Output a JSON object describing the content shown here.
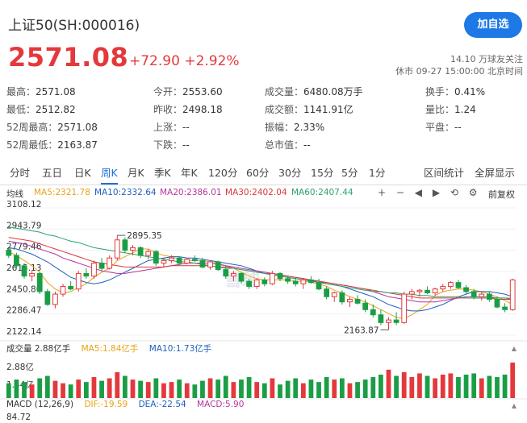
{
  "header": {
    "title": "上证50(SH:000016)",
    "follow_label": "加自选",
    "price": "2571.08",
    "change": "+72.90",
    "change_pct": "+2.92%",
    "followers": "14.10 万球友关注",
    "status": "休市 09-27 15:00:00 北京时间"
  },
  "quote": [
    [
      {
        "label": "最高：",
        "value": "2571.08",
        "color": "red"
      },
      {
        "label": "今开：",
        "value": "2553.60",
        "color": "red"
      },
      {
        "label": "成交量：",
        "value": "6480.08万手",
        "color": ""
      },
      {
        "label": "换手：",
        "value": "0.41%",
        "color": ""
      }
    ],
    [
      {
        "label": "最低：",
        "value": "2512.82",
        "color": "red"
      },
      {
        "label": "昨收：",
        "value": "2498.18",
        "color": ""
      },
      {
        "label": "成交额：",
        "value": "1141.91亿",
        "color": ""
      },
      {
        "label": "量比：",
        "value": "1.24",
        "color": "red"
      }
    ],
    [
      {
        "label": "52周最高：",
        "value": "2571.08",
        "color": ""
      },
      {
        "label": "上涨：",
        "value": "--",
        "color": ""
      },
      {
        "label": "振幅：",
        "value": "2.33%",
        "color": ""
      },
      {
        "label": "平盘：",
        "value": "--",
        "color": ""
      }
    ],
    [
      {
        "label": "52周最低：",
        "value": "2163.87",
        "color": ""
      },
      {
        "label": "下跌：",
        "value": "--",
        "color": ""
      },
      {
        "label": "总市值：",
        "value": "--",
        "color": ""
      }
    ]
  ],
  "tabs": [
    "分时",
    "五日",
    "日K",
    "周K",
    "月K",
    "季K",
    "年K",
    "120分",
    "60分",
    "30分",
    "15分",
    "5分",
    "1分"
  ],
  "active_tab": "周K",
  "tab_actions": [
    "区间统计",
    "全屏显示"
  ],
  "ma_line": {
    "label": "均线",
    "items": [
      {
        "text": "MA5:2321.78",
        "color": "#e8a317"
      },
      {
        "text": "MA10:2332.64",
        "color": "#1f5fbf"
      },
      {
        "text": "MA20:2386.01",
        "color": "#b5359d"
      },
      {
        "text": "MA30:2402.04",
        "color": "#d9383a"
      },
      {
        "text": "MA60:2407.44",
        "color": "#2ca36d"
      }
    ],
    "adjust": "前复权"
  },
  "watermark": "雪球",
  "chart_data": {
    "type": "candlestick",
    "y_ticks": [
      "3108.12",
      "2943.79",
      "2779.46",
      "2615.13",
      "2450.80",
      "2286.47",
      "2122.14"
    ],
    "ylim": [
      2122.14,
      3108.12
    ],
    "annotations": [
      {
        "text": "2895.35",
        "value": 2895.35
      },
      {
        "text": "2163.87",
        "value": 2163.87
      }
    ],
    "candles": [
      [
        2780,
        2800,
        2720,
        2740
      ],
      [
        2740,
        2760,
        2640,
        2660
      ],
      [
        2660,
        2680,
        2560,
        2580
      ],
      [
        2580,
        2620,
        2540,
        2600
      ],
      [
        2600,
        2610,
        2440,
        2460
      ],
      [
        2460,
        2480,
        2350,
        2360
      ],
      [
        2360,
        2460,
        2330,
        2440
      ],
      [
        2440,
        2520,
        2420,
        2500
      ],
      [
        2500,
        2540,
        2470,
        2480
      ],
      [
        2480,
        2620,
        2460,
        2600
      ],
      [
        2600,
        2640,
        2560,
        2580
      ],
      [
        2580,
        2700,
        2560,
        2680
      ],
      [
        2680,
        2720,
        2620,
        2640
      ],
      [
        2640,
        2740,
        2630,
        2720
      ],
      [
        2720,
        2895,
        2700,
        2860
      ],
      [
        2860,
        2880,
        2760,
        2780
      ],
      [
        2780,
        2820,
        2740,
        2800
      ],
      [
        2800,
        2810,
        2720,
        2740
      ],
      [
        2740,
        2790,
        2710,
        2770
      ],
      [
        2770,
        2780,
        2660,
        2680
      ],
      [
        2680,
        2720,
        2650,
        2700
      ],
      [
        2700,
        2740,
        2680,
        2720
      ],
      [
        2720,
        2730,
        2660,
        2680
      ],
      [
        2680,
        2720,
        2670,
        2710
      ],
      [
        2710,
        2740,
        2690,
        2700
      ],
      [
        2700,
        2720,
        2640,
        2650
      ],
      [
        2650,
        2700,
        2630,
        2690
      ],
      [
        2690,
        2700,
        2620,
        2630
      ],
      [
        2630,
        2660,
        2560,
        2580
      ],
      [
        2580,
        2620,
        2540,
        2600
      ],
      [
        2600,
        2610,
        2520,
        2540
      ],
      [
        2540,
        2560,
        2480,
        2500
      ],
      [
        2500,
        2560,
        2480,
        2550
      ],
      [
        2550,
        2570,
        2500,
        2520
      ],
      [
        2520,
        2620,
        2510,
        2600
      ],
      [
        2600,
        2610,
        2540,
        2560
      ],
      [
        2560,
        2580,
        2520,
        2540
      ],
      [
        2540,
        2570,
        2500,
        2520
      ],
      [
        2520,
        2560,
        2480,
        2550
      ],
      [
        2550,
        2580,
        2520,
        2530
      ],
      [
        2530,
        2560,
        2470,
        2480
      ],
      [
        2480,
        2500,
        2400,
        2420
      ],
      [
        2420,
        2460,
        2380,
        2450
      ],
      [
        2450,
        2470,
        2360,
        2380
      ],
      [
        2380,
        2420,
        2340,
        2400
      ],
      [
        2400,
        2430,
        2360,
        2370
      ],
      [
        2370,
        2400,
        2300,
        2320
      ],
      [
        2320,
        2360,
        2260,
        2280
      ],
      [
        2280,
        2320,
        2200,
        2220
      ],
      [
        2220,
        2260,
        2164,
        2240
      ],
      [
        2240,
        2300,
        2200,
        2220
      ],
      [
        2220,
        2460,
        2210,
        2440
      ],
      [
        2440,
        2480,
        2400,
        2460
      ],
      [
        2460,
        2480,
        2420,
        2470
      ],
      [
        2470,
        2500,
        2440,
        2450
      ],
      [
        2450,
        2490,
        2430,
        2480
      ],
      [
        2480,
        2520,
        2460,
        2500
      ],
      [
        2500,
        2540,
        2480,
        2530
      ],
      [
        2530,
        2550,
        2480,
        2490
      ],
      [
        2490,
        2510,
        2440,
        2460
      ],
      [
        2460,
        2480,
        2400,
        2420
      ],
      [
        2420,
        2460,
        2390,
        2440
      ],
      [
        2440,
        2460,
        2380,
        2400
      ],
      [
        2400,
        2420,
        2330,
        2340
      ],
      [
        2340,
        2370,
        2300,
        2320
      ],
      [
        2320,
        2560,
        2310,
        2550
      ]
    ],
    "ma_series": {
      "MA5": [
        2770,
        2740,
        2700,
        2660,
        2610,
        2530,
        2480,
        2450,
        2460,
        2490,
        2520,
        2570,
        2610,
        2640,
        2700,
        2730,
        2760,
        2790,
        2790,
        2760,
        2740,
        2730,
        2710,
        2700,
        2700,
        2700,
        2690,
        2680,
        2660,
        2640,
        2610,
        2580,
        2560,
        2550,
        2550,
        2550,
        2550,
        2540,
        2540,
        2530,
        2520,
        2500,
        2470,
        2450,
        2420,
        2400,
        2380,
        2350,
        2320,
        2290,
        2260,
        2250,
        2280,
        2320,
        2360,
        2430,
        2460,
        2470,
        2480,
        2480,
        2470,
        2460,
        2440,
        2420,
        2390,
        2360
      ],
      "MA10": [
        2800,
        2790,
        2770,
        2750,
        2720,
        2690,
        2650,
        2610,
        2570,
        2550,
        2530,
        2520,
        2530,
        2550,
        2580,
        2610,
        2640,
        2670,
        2700,
        2710,
        2720,
        2730,
        2730,
        2720,
        2720,
        2710,
        2700,
        2690,
        2680,
        2670,
        2660,
        2640,
        2620,
        2600,
        2590,
        2580,
        2570,
        2560,
        2550,
        2540,
        2540,
        2520,
        2510,
        2500,
        2480,
        2460,
        2440,
        2420,
        2390,
        2360,
        2340,
        2320,
        2310,
        2310,
        2320,
        2340,
        2360,
        2390,
        2420,
        2440,
        2460,
        2460,
        2460,
        2450,
        2440,
        2420
      ],
      "MA20": [
        2850,
        2840,
        2830,
        2810,
        2790,
        2770,
        2750,
        2720,
        2700,
        2680,
        2660,
        2640,
        2620,
        2610,
        2600,
        2600,
        2610,
        2620,
        2630,
        2640,
        2650,
        2660,
        2670,
        2680,
        2680,
        2680,
        2680,
        2670,
        2660,
        2650,
        2640,
        2630,
        2620,
        2610,
        2600,
        2590,
        2580,
        2570,
        2560,
        2550,
        2540,
        2530,
        2520,
        2510,
        2500,
        2490,
        2480,
        2460,
        2440,
        2420,
        2410,
        2400,
        2390,
        2380,
        2380,
        2380,
        2390,
        2400,
        2410,
        2420,
        2420,
        2420,
        2420,
        2410,
        2410,
        2400
      ],
      "MA30": [
        2880,
        2870,
        2860,
        2850,
        2830,
        2810,
        2790,
        2770,
        2750,
        2730,
        2710,
        2690,
        2680,
        2670,
        2660,
        2650,
        2650,
        2650,
        2650,
        2650,
        2650,
        2660,
        2660,
        2660,
        2660,
        2660,
        2660,
        2650,
        2650,
        2640,
        2630,
        2620,
        2610,
        2600,
        2600,
        2590,
        2580,
        2570,
        2560,
        2550,
        2540,
        2530,
        2520,
        2510,
        2500,
        2490,
        2480,
        2470,
        2460,
        2450,
        2440,
        2430,
        2420,
        2410,
        2410,
        2410,
        2410,
        2410,
        2410,
        2410,
        2410,
        2410,
        2410,
        2400,
        2400,
        2400
      ],
      "MA60": [
        2960,
        2950,
        2940,
        2930,
        2920,
        2900,
        2890,
        2870,
        2850,
        2840,
        2820,
        2800,
        2790,
        2780,
        2770,
        2760,
        2750,
        2740,
        2730,
        2720,
        2710,
        2700,
        2690,
        2690,
        2680,
        2670,
        2660,
        2650,
        2640,
        2640,
        2630,
        2620,
        2610,
        2600,
        2590,
        2580,
        2570,
        2560,
        2550,
        2540,
        2530,
        2520,
        2510,
        2500,
        2490,
        2480,
        2470,
        2460,
        2460,
        2450,
        2450,
        2440,
        2440,
        2430,
        2430,
        2420,
        2420,
        2420,
        2420,
        2410,
        2410,
        2410,
        2410,
        2410,
        2410,
        2407
      ]
    }
  },
  "volume": {
    "label": "成交量",
    "total": "2.88亿手",
    "ma5": "MA5:1.84亿手",
    "ma10": "MA10:1.73亿手",
    "y_ticks": [
      "2.88亿",
      "1.44亿"
    ],
    "max": 2.88,
    "bars": [
      1.2,
      1.5,
      1.3,
      1.1,
      1.6,
      1.8,
      1.4,
      1.2,
      1.1,
      1.5,
      1.3,
      1.7,
      1.4,
      1.6,
      2.1,
      1.8,
      1.5,
      1.4,
      1.3,
      1.6,
      1.2,
      1.3,
      1.5,
      1.2,
      1.1,
      1.4,
      1.6,
      1.5,
      1.8,
      1.3,
      1.5,
      1.7,
      1.3,
      1.2,
      1.6,
      1.1,
      1.4,
      1.6,
      1.2,
      1.5,
      1.3,
      1.7,
      1.5,
      1.6,
      1.2,
      1.3,
      1.5,
      1.7,
      1.9,
      2.3,
      1.8,
      2.1,
      1.7,
      2.0,
      1.8,
      1.6,
      1.9,
      2.0,
      1.7,
      1.9,
      2.0,
      1.6,
      1.8,
      1.7,
      1.9,
      2.88
    ]
  },
  "macd": {
    "label": "MACD (12,26,9)",
    "dif": "DIF:-19.59",
    "dea": "DEA:-22.54",
    "macd_val": "MACD:5.90",
    "y_tick": "84.72"
  }
}
